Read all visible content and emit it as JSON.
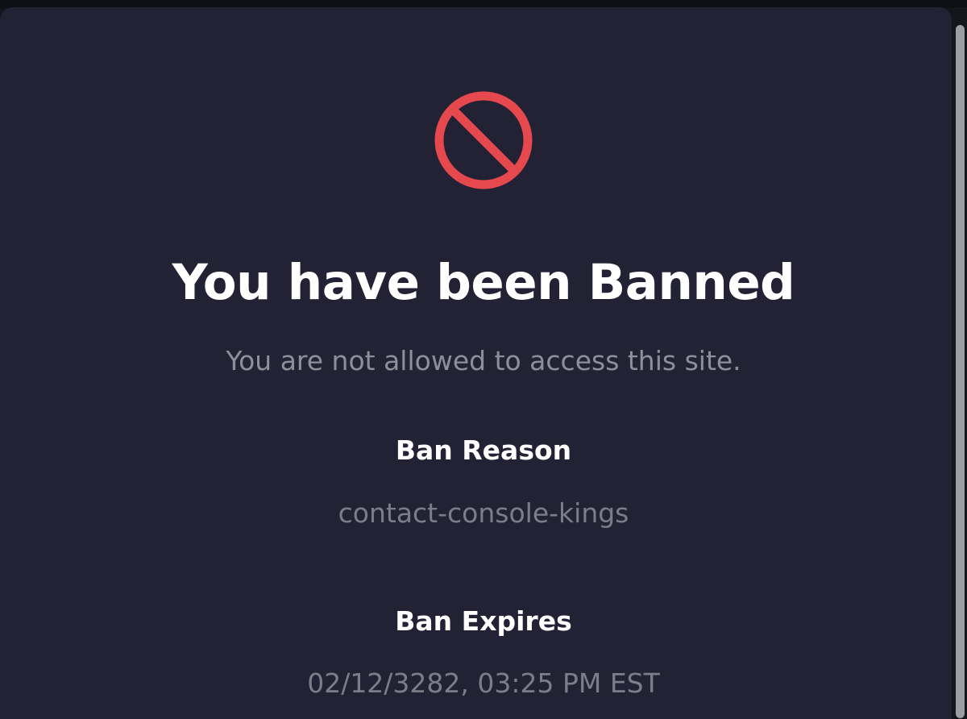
{
  "page": {
    "title": "You have been Banned",
    "subtitle": "You are not allowed to access this site.",
    "icon": "prohibited-icon",
    "accent_color": "#e5484d"
  },
  "ban": {
    "reason_label": "Ban Reason",
    "reason_value": "contact-console-kings",
    "expires_label": "Ban Expires",
    "expires_value": "02/12/3282, 03:25 PM EST"
  },
  "colors": {
    "background": "#222234",
    "title_text": "#ffffff",
    "muted_text": "#8f8f9b"
  }
}
